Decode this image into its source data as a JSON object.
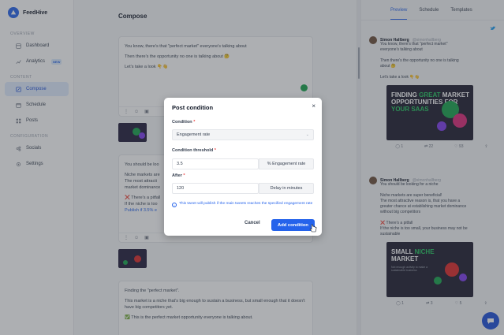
{
  "app": {
    "name": "FeedHive"
  },
  "sidebar": {
    "sections": [
      {
        "label": "OVERVIEW"
      },
      {
        "label": "CONTENT"
      },
      {
        "label": "CONFIGURATION"
      }
    ],
    "items": [
      {
        "label": "Dashboard",
        "icon": "dashboard-icon"
      },
      {
        "label": "Analytics",
        "icon": "analytics-icon",
        "badge": "NEW"
      },
      {
        "label": "Compose",
        "icon": "compose-icon",
        "active": true
      },
      {
        "label": "Schedule",
        "icon": "calendar-icon"
      },
      {
        "label": "Posts",
        "icon": "grid-icon"
      },
      {
        "label": "Socials",
        "icon": "socials-icon"
      },
      {
        "label": "Settings",
        "icon": "gear-icon"
      }
    ]
  },
  "compose": {
    "title": "Compose",
    "card1": {
      "lines": [
        "You know, there's that \"perfect market\" everyone's talking about",
        "Then there's the opportunity no one is talking about 🤔",
        "Let's take a look 👇👋"
      ]
    },
    "card2": {
      "lines": [
        "You should be loo",
        "Niche markets are",
        "The most attracti",
        "market dominance",
        "❌ There's a pitfall",
        "If the niche is too",
        "Publish if 3.5% e"
      ]
    },
    "card3": {
      "lines": [
        "Finding the \"perfect market\".",
        "This market is a niche that's big enough to sustain a business, but small enough that it doesn't have big competitors yet.",
        "✅ This is the perfect market opportunity everyone is talking about."
      ]
    }
  },
  "preview": {
    "tabs": [
      "Preview",
      "Schedule",
      "Templates"
    ],
    "active_tab": "Preview",
    "tweet1": {
      "name": "Simon Hallberg",
      "handle": "@simonhallberg",
      "lines": [
        "You know, there's that \"perfect market\"",
        "everyone's talking about",
        "",
        "Then there's the opportunity no one is talking",
        "about 🤔",
        "",
        "Let's take a look 👇👋"
      ],
      "image_line1": "FINDING ",
      "image_hl": "GREAT",
      "image_line1b": " MARKET",
      "image_line2": "OPPORTUNITIES FOR",
      "image_line3": "YOUR SAAS",
      "actions": {
        "reply": "1",
        "retweet": "22",
        "like": "93"
      }
    },
    "tweet2": {
      "name": "Simon Hallberg",
      "handle": "@simonhallberg",
      "lines": [
        "You should be looking for a niche",
        "",
        "Niche markets are super beneficial!",
        "The most attractive reason is, that you have a",
        "greater chance at establishing market dominance",
        "without big competitors",
        "",
        "❌ There's a pitfall",
        "If the niche is too small, your business may not be",
        "sustainable"
      ],
      "image_line1": "SMALL ",
      "image_hl": "NICHE",
      "image_line2": "MARKET",
      "image_sub": "Not enough activity to make a sustainable business",
      "actions": {
        "reply": "1",
        "retweet": "3",
        "like": "5"
      }
    }
  },
  "modal": {
    "title": "Post condition",
    "condition_label": "Condition",
    "condition_value": "Engagement rate",
    "threshold_label": "Condition threshold",
    "threshold_value": "3.5",
    "threshold_unit": "% Engagement rate",
    "after_label": "After",
    "after_value": "120",
    "after_unit": "Delay in minutes",
    "info": "This tweet will publish if the main tweets reaches the specified engagement rate",
    "cancel": "Cancel",
    "submit": "Add condition",
    "required_mark": "*"
  }
}
